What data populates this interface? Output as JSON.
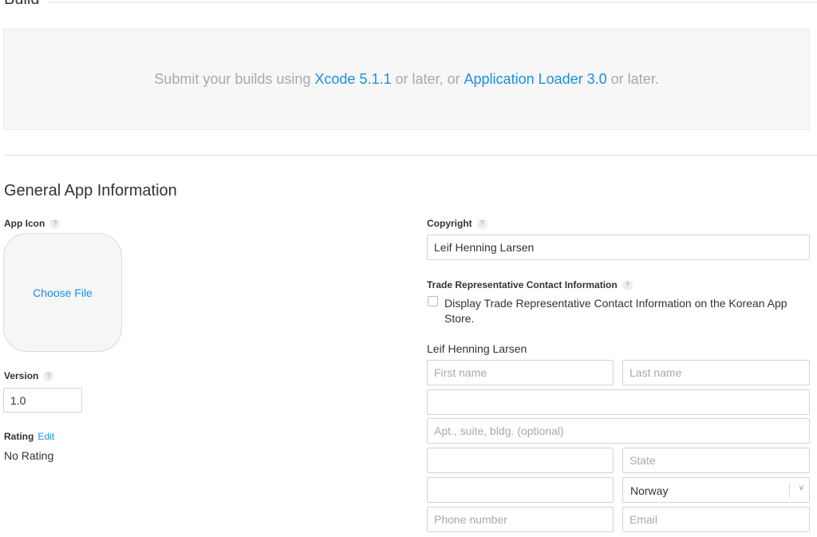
{
  "build": {
    "title": "Build",
    "message_pre": "Submit your builds using ",
    "xcode_link": "Xcode 5.1.1",
    "message_mid": " or later, or ",
    "loader_link": "Application Loader 3.0",
    "message_post": " or later."
  },
  "general": {
    "title": "General App Information",
    "app_icon_label": "App Icon",
    "help_glyph": "?",
    "choose_file": "Choose File",
    "version_label": "Version",
    "version_value": "1.0",
    "rating_label": "Rating",
    "rating_edit": "Edit",
    "rating_value": "No Rating"
  },
  "copyright": {
    "label": "Copyright",
    "value": "Leif Henning Larsen"
  },
  "trade": {
    "label": "Trade Representative Contact Information",
    "checkbox_label": "Display Trade Representative Contact Information on the Korean App Store.",
    "checkbox_checked": false,
    "contact_name": "Leif Henning Larsen",
    "first_name": {
      "value": "",
      "placeholder": "First name"
    },
    "last_name": {
      "value": "",
      "placeholder": "Last name"
    },
    "address": {
      "value": "",
      "placeholder": ""
    },
    "address2": {
      "value": "",
      "placeholder": "Apt., suite, bldg. (optional)"
    },
    "city": {
      "value": "",
      "placeholder": ""
    },
    "state": {
      "value": "",
      "placeholder": "State"
    },
    "postal": {
      "value": "",
      "placeholder": ""
    },
    "country": "Norway",
    "phone": {
      "value": "",
      "placeholder": "Phone number"
    },
    "email": {
      "value": "",
      "placeholder": "Email"
    }
  },
  "icons": {
    "help": "question-circle-icon",
    "dropdown": "chevron-down-icon"
  },
  "colors": {
    "link": "#1a8fe3",
    "muted_text": "#a9a9a9",
    "panel_bg": "#f7f7f7"
  }
}
